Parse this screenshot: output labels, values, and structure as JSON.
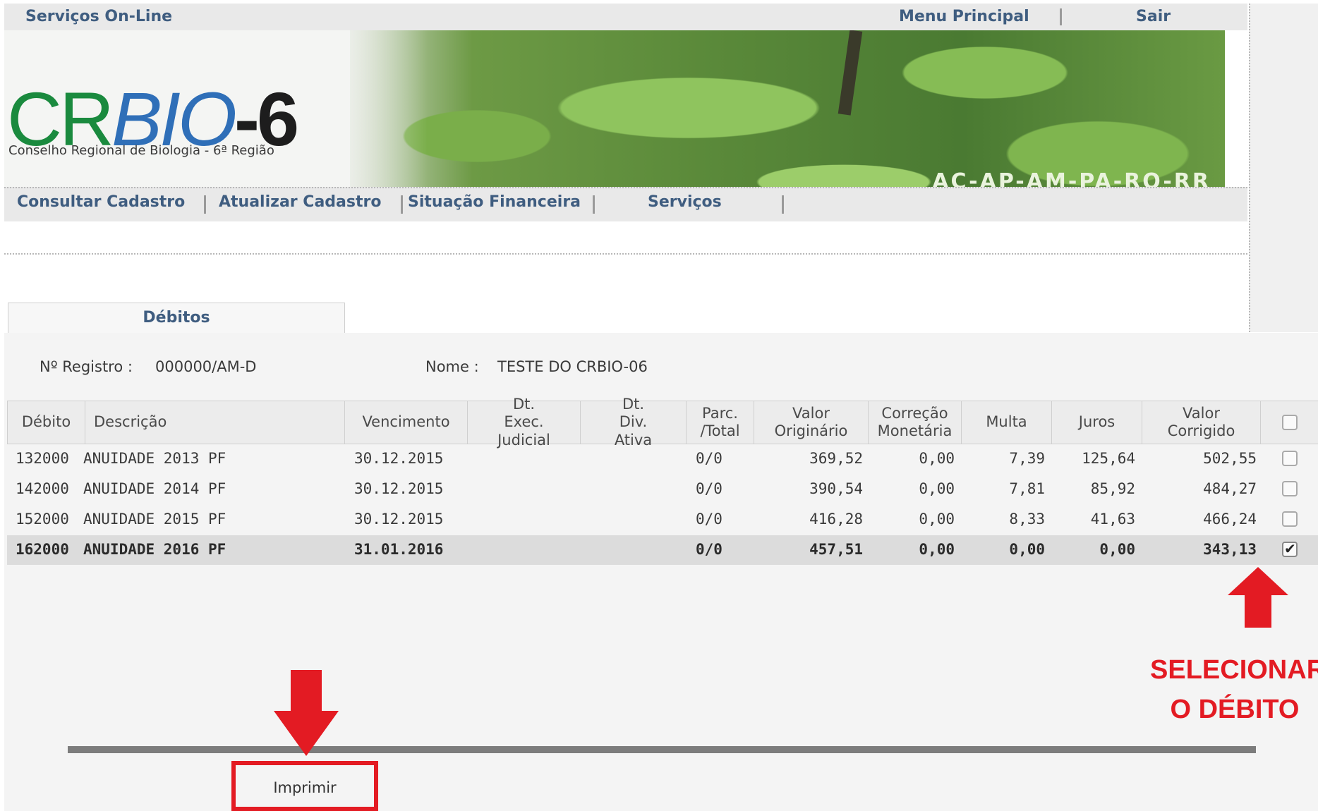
{
  "header": {
    "services_online": "Serviços On-Line",
    "menu_principal": "Menu Principal",
    "sair": "Sair"
  },
  "logo": {
    "cr": "CR",
    "bio": "BIO",
    "six": "-6",
    "subtitle": "Conselho Regional de Biologia - 6ª Região",
    "states": "AC-AP-AM-PA-RO-RR"
  },
  "nav": {
    "consultar": "Consultar Cadastro",
    "atualizar": "Atualizar Cadastro",
    "situacao": "Situação Financeira",
    "servicos": "Serviços"
  },
  "tab": {
    "label": "Débitos"
  },
  "info": {
    "registro_label": "Nº Registro :",
    "registro_value": "000000/AM-D",
    "nome_label": "Nome :",
    "nome_value": "TESTE DO CRBIO-06"
  },
  "table": {
    "headers": [
      "Débito",
      "Descrição",
      "Vencimento",
      "Dt. Exec. Judicial",
      "Dt. Div. Ativa",
      "Parc. /Total",
      "Valor Originário",
      "Correção Monetária",
      "Multa",
      "Juros",
      "Valor Corrigido"
    ],
    "rows": [
      {
        "debito": "132000",
        "descricao": "ANUIDADE 2013 PF",
        "vencimento": "30.12.2015",
        "dt_exec": "",
        "dt_div": "",
        "parc": "0/0",
        "valor_orig": "369,52",
        "correcao": "0,00",
        "multa": "7,39",
        "juros": "125,64",
        "valor_corr": "502,55",
        "checked": false
      },
      {
        "debito": "142000",
        "descricao": "ANUIDADE 2014 PF",
        "vencimento": "30.12.2015",
        "dt_exec": "",
        "dt_div": "",
        "parc": "0/0",
        "valor_orig": "390,54",
        "correcao": "0,00",
        "multa": "7,81",
        "juros": "85,92",
        "valor_corr": "484,27",
        "checked": false
      },
      {
        "debito": "152000",
        "descricao": "ANUIDADE 2015 PF",
        "vencimento": "30.12.2015",
        "dt_exec": "",
        "dt_div": "",
        "parc": "0/0",
        "valor_orig": "416,28",
        "correcao": "0,00",
        "multa": "8,33",
        "juros": "41,63",
        "valor_corr": "466,24",
        "checked": false
      },
      {
        "debito": "162000",
        "descricao": "ANUIDADE 2016 PF",
        "vencimento": "31.01.2016",
        "dt_exec": "",
        "dt_div": "",
        "parc": "0/0",
        "valor_orig": "457,51",
        "correcao": "0,00",
        "multa": "0,00",
        "juros": "0,00",
        "valor_corr": "343,13",
        "checked": true
      }
    ]
  },
  "annotation": {
    "line1": "SELECIONAR",
    "line2": "O DÉBITO",
    "color": "#e31b23"
  },
  "print_button": {
    "label": "Imprimir"
  },
  "colors": {
    "link": "#3f5d80",
    "accent_red": "#e31b23"
  }
}
